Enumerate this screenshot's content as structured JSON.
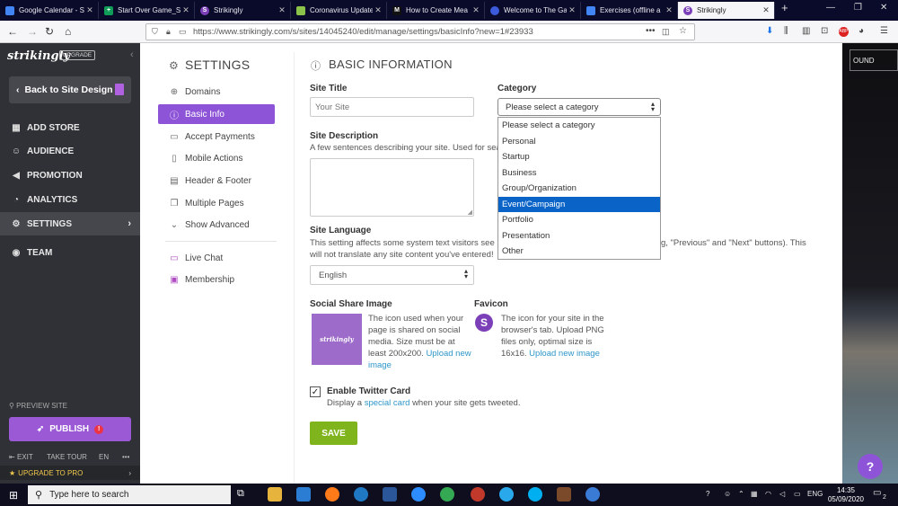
{
  "browser": {
    "tabs": [
      {
        "title": "Google Calendar - S",
        "icon": "calendar-icon",
        "color": "#4285f4"
      },
      {
        "title": "Start Over Game_St",
        "icon": "sheets-icon",
        "color": "#0f9d58"
      },
      {
        "title": "Strikingly",
        "icon": "strikingly-icon",
        "color": "#7b3fb8"
      },
      {
        "title": "Coronavirus Update",
        "icon": "worldometer-icon",
        "color": "#9c27b0"
      },
      {
        "title": "How to Create Mea",
        "icon": "medium-icon",
        "color": "#111111"
      },
      {
        "title": "Welcome to The Ga",
        "icon": "site-icon",
        "color": "#3b5bdb"
      },
      {
        "title": "Exercises (offline a",
        "icon": "docs-icon",
        "color": "#4285f4"
      },
      {
        "title": "Strikingly",
        "icon": "strikingly-icon",
        "color": "#7b3fb8",
        "active": true
      }
    ],
    "url": "https://www.strikingly.com/s/sites/14045240/edit/manage/settings/basicInfo?new=1#23933",
    "url_menu": "•••"
  },
  "sidebar": {
    "logo": "strikingly",
    "upgrade_badge": "UPGRADE",
    "back_label": "Back to Site Design",
    "items": [
      {
        "label": "ADD STORE",
        "icon": "store-icon"
      },
      {
        "label": "AUDIENCE",
        "icon": "audience-icon"
      },
      {
        "label": "PROMOTION",
        "icon": "megaphone-icon"
      },
      {
        "label": "ANALYTICS",
        "icon": "analytics-icon"
      },
      {
        "label": "SETTINGS",
        "icon": "gear-icon",
        "active": true
      },
      {
        "label": "TEAM",
        "icon": "team-icon"
      }
    ],
    "preview_site": "PREVIEW SITE",
    "publish_label": "PUBLISH",
    "publish_alert": "!",
    "exit": "EXIT",
    "take_tour": "TAKE TOUR",
    "lang": "EN",
    "more": "•••",
    "upgrade_pro": "UPGRADE TO PRO"
  },
  "settings_nav": {
    "title": "SETTINGS",
    "items": [
      {
        "label": "Domains",
        "icon": "globe-icon"
      },
      {
        "label": "Basic Info",
        "icon": "info-icon",
        "active": true
      },
      {
        "label": "Accept Payments",
        "icon": "card-icon"
      },
      {
        "label": "Mobile Actions",
        "icon": "mobile-icon"
      },
      {
        "label": "Header & Footer",
        "icon": "layout-icon"
      },
      {
        "label": "Multiple Pages",
        "icon": "pages-icon"
      },
      {
        "label": "Show Advanced",
        "icon": "chevron-down-icon"
      }
    ],
    "extras": [
      {
        "label": "Live Chat",
        "icon": "chat-icon"
      },
      {
        "label": "Membership",
        "icon": "membership-icon"
      }
    ]
  },
  "basic_info": {
    "title": "BASIC INFORMATION",
    "site_title_label": "Site Title",
    "site_title_placeholder": "Your Site",
    "category_label": "Category",
    "category_selected": "Please select a category",
    "category_options": [
      "Please select a category",
      "Personal",
      "Startup",
      "Business",
      "Group/Organization",
      "Event/Campaign",
      "Portfolio",
      "Presentation",
      "Other"
    ],
    "category_highlighted": "Event/Campaign",
    "description_label": "Site Description",
    "description_hint": "A few sentences describing your site. Used for sea",
    "language_label": "Site Language",
    "language_hint_1": "This setting affects some system text visitors see",
    "language_hint_1_tail": "g, \"Previous\" and \"Next\" buttons). This",
    "language_hint_2": "will not translate any site content you've entered!",
    "language_value": "English",
    "social_label": "Social Share Image",
    "social_hint": "The icon used when your page is shared on social media. Size must be at least 200x200.",
    "social_link": "Upload new image",
    "social_thumb": "strikingly",
    "favicon_label": "Favicon",
    "favicon_letter": "S",
    "favicon_hint": "The icon for your site in the browser's tab. Upload PNG files only, optimal size is 16x16.",
    "favicon_link": "Upload new image",
    "twitter_label": "Enable Twitter Card",
    "twitter_checked": true,
    "twitter_hint_pre": "Display a",
    "twitter_link": "special card",
    "twitter_hint_post": "when your site gets tweeted.",
    "save_label": "SAVE"
  },
  "preview": {
    "button_fragment": "OUND",
    "help": "?"
  },
  "taskbar": {
    "search_placeholder": "Type here to search",
    "lang": "ENG",
    "time": "14:35",
    "date": "05/09/2020",
    "notifications": "2"
  }
}
